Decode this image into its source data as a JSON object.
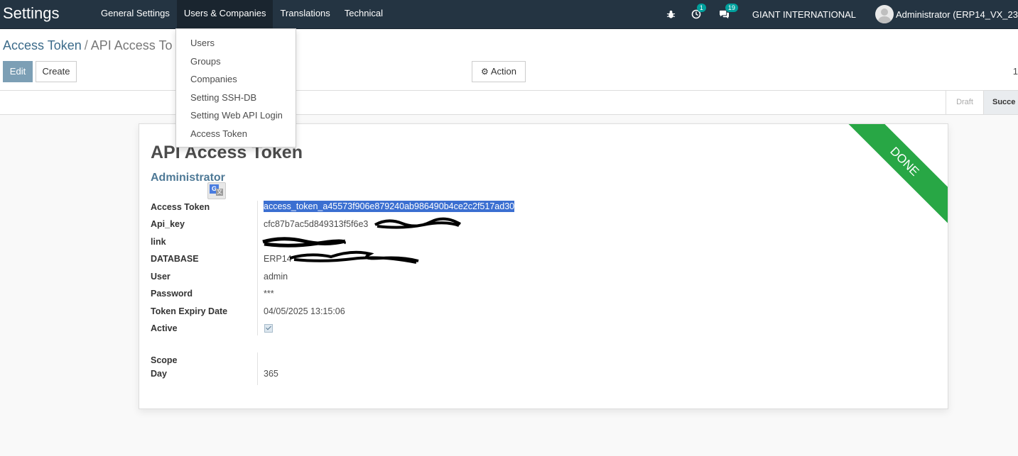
{
  "navbar": {
    "brand": "Settings",
    "menus": [
      "General Settings",
      "Users & Companies",
      "Translations",
      "Technical"
    ],
    "activity_badge": "1",
    "messages_badge": "19",
    "company": "GIANT INTERNATIONAL",
    "user": "Administrator (ERP14_VX_23"
  },
  "dropdown": {
    "items": [
      "Users",
      "Groups",
      "Companies",
      "Setting SSH-DB",
      "Setting Web API Login",
      "Access Token"
    ]
  },
  "breadcrumb": {
    "parent": "Access Token",
    "separator": "/",
    "current": "API Access To"
  },
  "buttons": {
    "edit": "Edit",
    "create": "Create",
    "action": "Action"
  },
  "pager": "1",
  "statusbar": {
    "draft": "Draft",
    "success": "Succe"
  },
  "record": {
    "ribbon": "DONE",
    "title": "API Access Token",
    "subtitle": "Administrator",
    "fields": {
      "access_token_label": "Access Token",
      "access_token_value": "access_token_a45573f906e879240ab986490b4ce2c2f517ad30",
      "api_key_label": "Api_key",
      "api_key_value": "cfc87b7ac5d849313f5f6e3",
      "link_label": "link",
      "database_label": "DATABASE",
      "database_value": "ERP14",
      "user_label": "User",
      "user_value": "admin",
      "password_label": "Password",
      "password_value": "***",
      "expiry_label": "Token Expiry Date",
      "expiry_value": "04/05/2025 13:15:06",
      "active_label": "Active",
      "active_value": true,
      "scope_label": "Scope",
      "day_label": "Day",
      "day_value": "365"
    }
  },
  "colors": {
    "navbar_bg": "#243442",
    "ribbon_green": "#28a745",
    "link_blue": "#3c6b8a",
    "badge_teal": "#00a09d"
  },
  "icons": [
    "bug-icon",
    "clock-icon",
    "chat-icon",
    "avatar-icon",
    "gear-icon",
    "translate-icon"
  ]
}
